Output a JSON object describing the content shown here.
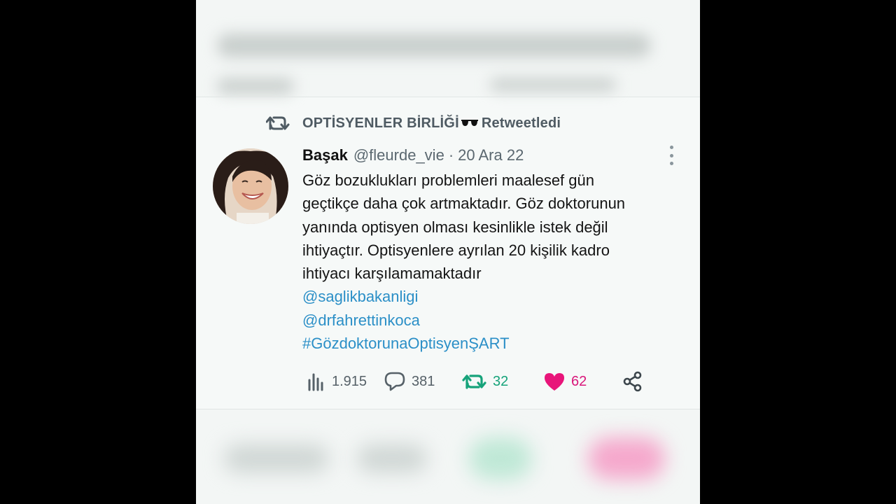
{
  "retweet_header": {
    "label": "OPTİSYENLER BİRLİĞİ",
    "suffix": "Retweetledi",
    "icon": "retweet-icon",
    "emoji": "sunglasses"
  },
  "tweet": {
    "author_name": "Başak",
    "handle": "@fleurde_vie",
    "separator": "·",
    "date": "20 Ara 22",
    "body_lines": [
      "Göz bozuklukları problemleri maalesef gün",
      "geçtikçe daha çok artmaktadır. Göz doktorunun",
      "yanında optisyen olması kesinlikle istek değil",
      "ihtiyaçtır. Optisyenlere ayrılan 20 kişilik kadro",
      "ihtiyacı karşılamamaktadır"
    ],
    "mentions": [
      "@saglikbakanligi",
      "@drfahrettinkoca"
    ],
    "hashtag": "#GözdoktorunaOptisyenŞART"
  },
  "actions": {
    "views": "1.915",
    "replies": "381",
    "retweets": "32",
    "likes": "62"
  },
  "colors": {
    "link": "#2b8fc7",
    "retweet": "#16a37a",
    "like": "#d9167a",
    "muted": "#566168"
  }
}
